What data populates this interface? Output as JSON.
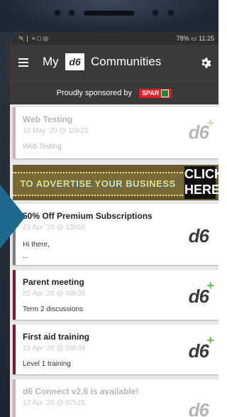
{
  "status_bar": {
    "left": "³ᵍ.❘ ≈ □ ◎",
    "right": "78% ▭ 11:25"
  },
  "app_bar": {
    "title_my": "My",
    "logo": "d6",
    "title_rest": "Communities"
  },
  "sponsor": {
    "label": "Proudly sponsored by",
    "brand": "SPAR"
  },
  "banner": {
    "text": "TO ADVERTISE YOUR BUSINESS",
    "click": "CLICK HERE"
  },
  "cards": [
    {
      "title": "Web Testing",
      "date": "19 May '20 @ 10h23",
      "body": "Web Testing",
      "body2": "",
      "logo": "d6",
      "plus": "+",
      "faded": true
    },
    {
      "title": "50% Off Premium Subscriptions",
      "date": "23 Apr '20 @ 13h56",
      "body": "Hi there,",
      "body2": "...",
      "logo": "d6",
      "plus": "",
      "faded": false
    },
    {
      "title": "Parent meeting",
      "date": "22 Apr '20 @ 08h35",
      "body": "Term 2 discussions",
      "body2": "",
      "logo": "d6",
      "plus": "+",
      "faded": false
    },
    {
      "title": "First aid training",
      "date": "22 Apr '20 @ 08h34",
      "body": "Level 1 training",
      "body2": "",
      "logo": "d6",
      "plus": "+",
      "faded": false
    },
    {
      "title": "d6 Connect v2.8 is available!",
      "date": "17 Apr '20 @ 07h15",
      "body": "",
      "body2": "",
      "logo": "d6",
      "plus": "",
      "faded": true
    }
  ],
  "colors": {
    "appbar": "#3a3a3a",
    "card_border_default": "#d7b2b5",
    "card_border_dark": "#7a1e2a",
    "accent_green": "#6cc04a",
    "arrow": "#1e6a8f"
  }
}
